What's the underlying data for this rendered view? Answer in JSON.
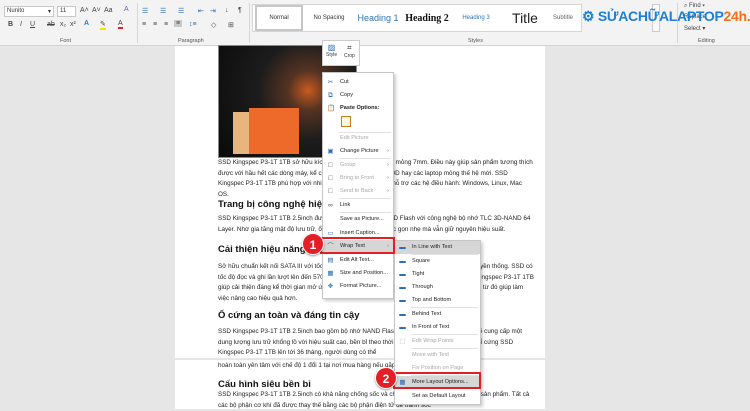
{
  "ribbon": {
    "font_name": "Nunito",
    "font_size": "11",
    "case_label": "Aa",
    "font_group": "Font",
    "paragraph_group": "Paragraph",
    "styles_group": "Styles",
    "editing_group": "Editing",
    "styles": [
      "Normal",
      "No Spacing",
      "Heading 1",
      "Heading 2",
      "Heading 3",
      "Title",
      "Subtitle"
    ],
    "find": "Find",
    "replace": "Replace",
    "select": "Select"
  },
  "logo": {
    "text_main": "SỬACHỮALAPTOP",
    "text_accent": "24h.com"
  },
  "mini_toolbar": {
    "style": "Style",
    "crop": "Crop"
  },
  "context_menu": {
    "items": [
      "Cut",
      "Copy",
      "Paste Options:",
      "Edit Picture",
      "Change Picture",
      "Group",
      "Bring to Front",
      "Send to Back",
      "Link",
      "Save as Picture...",
      "Insert Caption...",
      "Wrap Text",
      "Edit Alt Text...",
      "Size and Position...",
      "Format Picture..."
    ]
  },
  "wrap_submenu": {
    "items": [
      "In Line with Text",
      "Square",
      "Tight",
      "Through",
      "Top and Bottom",
      "Behind Text",
      "In Front of Text",
      "Edit Wrap Points",
      "Move with Text",
      "Fix Position on Page",
      "More Layout Options...",
      "Set as Default Layout"
    ]
  },
  "badges": [
    "1",
    "2"
  ],
  "document": {
    "p1": "SSD Kingspec P3-1T 1TB sở hữu kích thước chuẩn 2.5inch và mỏng 7mm. Điều này giúp sản phẩm tương thích được với hầu hết các dòng máy, kể cả laptop đời cũ dùng ổ HDD hay các laptop mỏng thế hệ mới. SSD Kingspec P3-1T 1TB phù hợp với nhiều dòng máy khác nhau, hỗ trợ các hệ điều hành: Windows, Linux, Mac OS.",
    "h1": "Trang bị công nghệ hiện đại",
    "p2": "SSD Kingspec P3-1T 1TB 2.5inch được trang bị chip nhớ NAND Flash với công nghệ bộ nhớ TLC 3D-NAND 64 Layer. Nhờ gia tăng mật độ lưu trữ, ổ cứng đảm bảo kích thước gọn nhẹ mà vẫn giữ nguyên hiệu suất.",
    "h2": "Cải thiện hiệu năng chuyên nghiệp",
    "p3": "Sở hữu chuẩn kết nối SATA III với tốc độ truyền tải dữ liệu nhanh gấp 10 lần so với ổ cứng truyền thống. SSD có tốc độ đọc và ghi lần lượt lên đến 570MB/s và 500MB/s, đáp ứng tốt nhu cầu sử dụng. SSD Kingspec P3-1T 1TB giúp cải thiện đáng kể thời gian mở ứng dụng, khởi động laptop nhanh chóng chưa đến 10s,... từ đó giúp làm việc nâng cao hiệu quả hơn.",
    "h3": "Ổ cứng an toàn và đáng tin cậy",
    "p4": "SSD Kingspec P3-1T 1TB 2.5inch bao gồm bộ nhớ NAND Flash và chip điều khiển bán dẫn sẽ cung cấp một dung lượng lưu trữ khổng lồ với hiệu suất cao, bền bỉ theo thời gian. Thời gian bảo hành của ổ cứng SSD Kingspec P3-1T 1TB lên tới 36 tháng, người dùng có thể",
    "p5": "hoàn toàn yên tâm với chế độ 1 đổi 1 tại nơi mua hàng nếu gặp lỗi trong quá trình sử dụng.",
    "h4": "Cấu hình siêu bền bỉ",
    "p6": "SSD Kingspec P3-1T 1TB 2.5inch có khả năng chống sốc và chống rung, độ bền cấy cao cho sản phẩm. Tất cả các bộ phận cơ khí đã được thay thế bằng các bộ phận điện tử để tránh sốc"
  }
}
